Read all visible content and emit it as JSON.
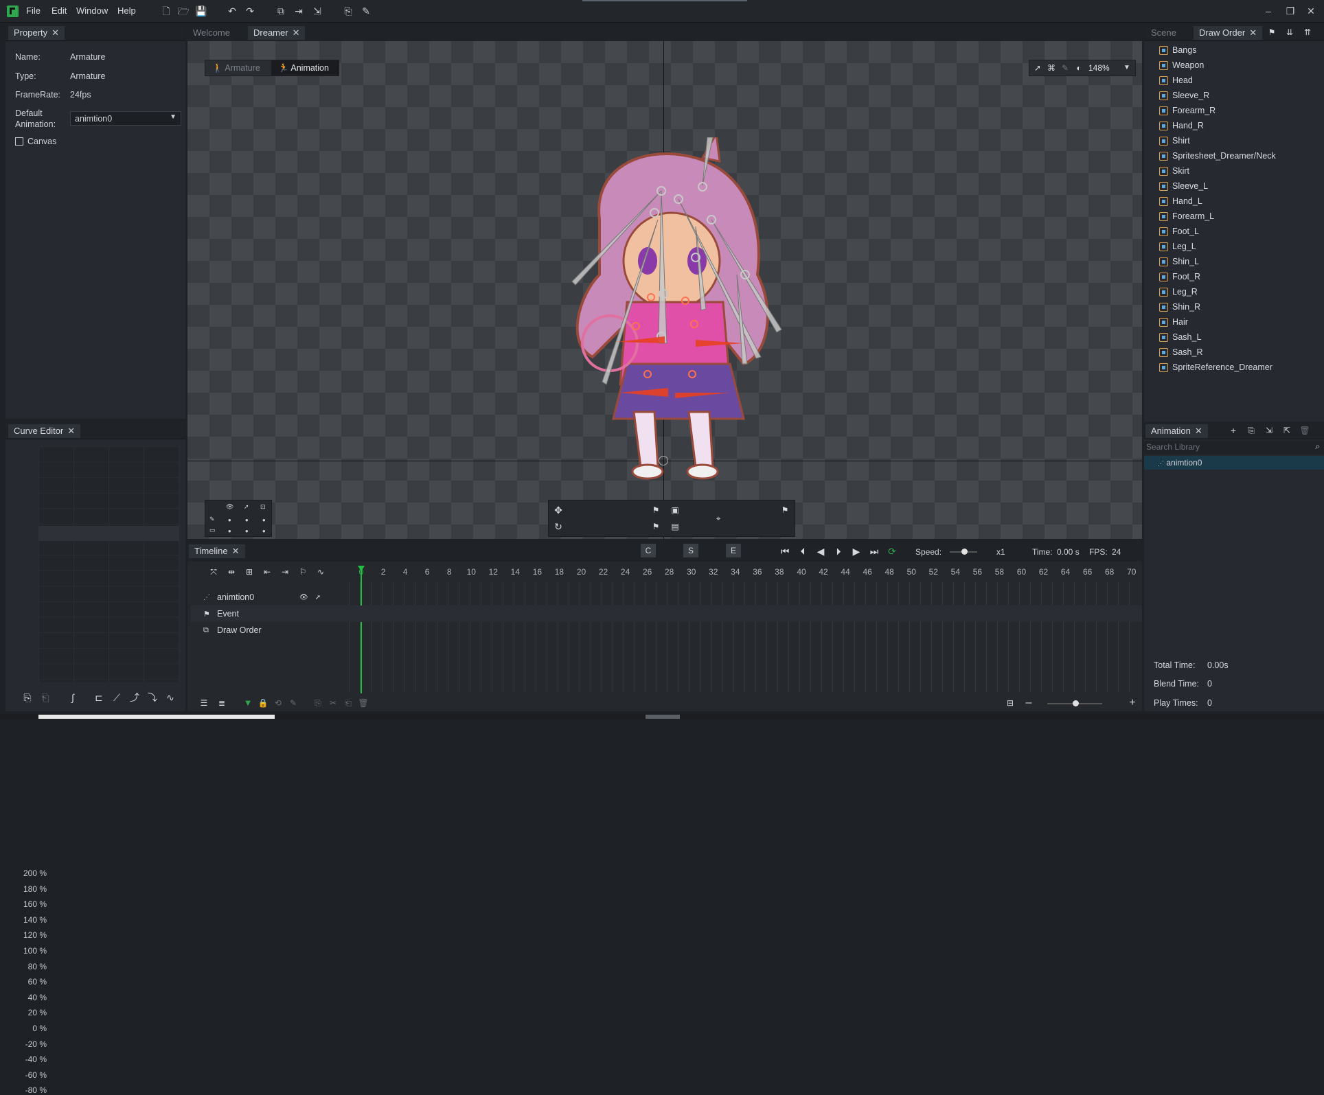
{
  "menu": [
    "File",
    "Edit",
    "Window",
    "Help"
  ],
  "property_panel": {
    "tab": "Property",
    "name_label": "Name:",
    "name_value": "Armature",
    "type_label": "Type:",
    "type_value": "Armature",
    "framerate_label": "FrameRate:",
    "framerate_value": "24fps",
    "default_anim_label_1": "Default",
    "default_anim_label_2": "Animation:",
    "default_anim_value": "animtion0",
    "canvas_label": "Canvas"
  },
  "editor_tabs": [
    "Welcome",
    "Dreamer"
  ],
  "mode_buttons": {
    "armature": "Armature",
    "animation": "Animation"
  },
  "zoom": "148%",
  "right_tabs": [
    "Scene",
    "Draw Order"
  ],
  "draw_order": [
    "Bangs",
    "Weapon",
    "Head",
    "Sleeve_R",
    "Forearm_R",
    "Hand_R",
    "Shirt",
    "Spritesheet_Dreamer/Neck",
    "Skirt",
    "Sleeve_L",
    "Hand_L",
    "Forearm_L",
    "Foot_L",
    "Leg_L",
    "Shin_L",
    "Foot_R",
    "Leg_R",
    "Shin_R",
    "Hair",
    "Sash_L",
    "Sash_R",
    "SpriteReference_Dreamer"
  ],
  "animation_panel": {
    "tab": "Animation",
    "search_placeholder": "Search Library",
    "item": "animtion0",
    "total_time_label": "Total Time:",
    "total_time": "0.00s",
    "blend_time_label": "Blend Time:",
    "blend_time": "0",
    "play_times_label": "Play Times:",
    "play_times": "0"
  },
  "curve_editor": {
    "tab": "Curve Editor",
    "labels": [
      "200 %",
      "180 %",
      "160 %",
      "140 %",
      "120 %",
      "100 %",
      "80 %",
      "60 %",
      "40 %",
      "20 %",
      "0 %",
      "-20 %",
      "-40 %",
      "-60 %",
      "-80 %"
    ]
  },
  "timeline": {
    "tab": "Timeline",
    "c_label": "C",
    "s_label": "S",
    "e_label": "E",
    "speed_label": "Speed:",
    "speed_value": "x1",
    "time_label": "Time:",
    "time_value": "0.00 s",
    "fps_label": "FPS:",
    "fps_value": "24",
    "ticks": [
      "0",
      "2",
      "4",
      "6",
      "8",
      "10",
      "12",
      "14",
      "16",
      "18",
      "20",
      "22",
      "24",
      "26",
      "28",
      "30",
      "32",
      "34",
      "36",
      "38",
      "40",
      "42",
      "44",
      "46",
      "48",
      "50",
      "52",
      "54",
      "56",
      "58",
      "60",
      "62",
      "64",
      "66",
      "68",
      "70"
    ],
    "rows": [
      "animtion0",
      "Event",
      "Draw Order"
    ]
  },
  "colors": {
    "accent": "#2fa84f",
    "playhead": "#22c040",
    "bone": "#c8c8c8"
  }
}
